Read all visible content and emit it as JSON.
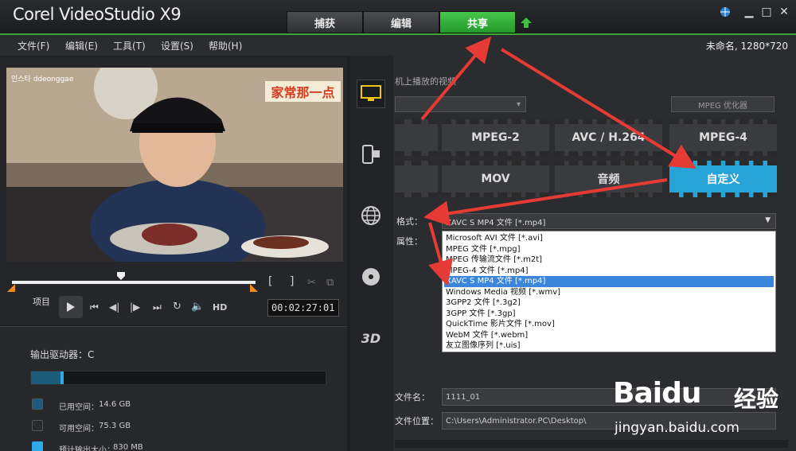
{
  "app": {
    "title": "Corel VideoStudio X9"
  },
  "tabs": [
    {
      "label": "捕获"
    },
    {
      "label": "编辑"
    },
    {
      "label": "共享"
    }
  ],
  "window": {
    "status": "未命名, 1280*720"
  },
  "menu": [
    "文件(F)",
    "编辑(E)",
    "工具(T)",
    "设置(S)",
    "帮助(H)"
  ],
  "preview": {
    "watermark": "인스타 ddeonggae",
    "caption": "家常那一点",
    "project_label": "项目",
    "hd_label": "HD",
    "timecode": "00:02:27:01"
  },
  "storage": {
    "drive_label": "输出驱动器：C",
    "used_label": "已用空间：",
    "used_value": "14.6 GB",
    "free_label": "可用空间：",
    "free_value": "75.3 GB",
    "est_label": "预计输出大小：",
    "est_value": "830 MB",
    "used_fraction": 0.16,
    "colors": {
      "used": "#1c5b7a",
      "free": "#2a2b2e",
      "est": "#2fa9e8"
    }
  },
  "share": {
    "header_partial": "机上播放的视频",
    "profile_btn": "MPEG 优化器",
    "formats_row1": [
      "MPEG-2",
      "AVC / H.264",
      "MPEG-4"
    ],
    "formats_row2": [
      "MOV",
      "音频",
      "自定义"
    ],
    "format_label": "格式：",
    "format_value": "XAVC S MP4 文件 [*.mp4]",
    "properties_label": "属性：",
    "options": [
      "Microsoft AVI 文件 [*.avi]",
      "MPEG 文件 [*.mpg]",
      "MPEG 传输流文件 [*.m2t]",
      "MPEG-4 文件 [*.mp4]",
      "XAVC S MP4 文件 [*.mp4]",
      "Windows Media 视频 [*.wmv]",
      "3GPP2 文件 [*.3g2]",
      "3GPP 文件 [*.3gp]",
      "QuickTime 影片文件 [*.mov]",
      "WebM 文件 [*.webm]",
      "友立图像序列 [*.uis]"
    ],
    "selected_option_index": 4,
    "filename_label": "文件名：",
    "filename_value": "1111_01",
    "location_label": "文件位置：",
    "location_value": "C:\\Users\\Administrator.PC\\Desktop\\"
  },
  "baidu": {
    "logo": "Baidu",
    "suffix": "经验",
    "url": "jingyan.baidu.com"
  }
}
